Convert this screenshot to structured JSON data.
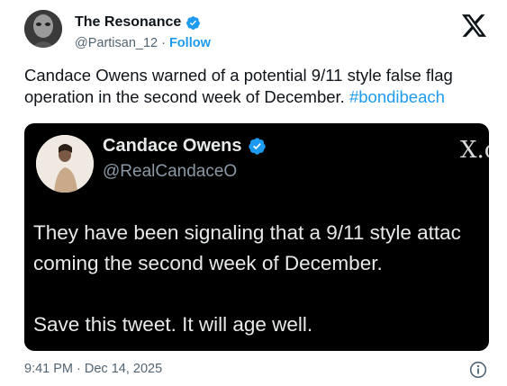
{
  "author": {
    "name": "The Resonance",
    "handle": "@Partisan_12",
    "separator": "·",
    "follow_label": "Follow",
    "verified_icon": "verified-badge-icon"
  },
  "brand_icon": "x-logo-icon",
  "tweet": {
    "text": "Candace Owens warned of a potential 9/11 style false flag operation in the second week of December.",
    "hashtag": "#bondibeach"
  },
  "quoted_tweet": {
    "name": "Candace Owens",
    "handle": "@RealCandaceO",
    "brand_glyph": "X.c",
    "line_1": "They have been signaling that a 9/11 style attac",
    "line_2": "coming the second week of December.",
    "line_3": "Save this tweet. It will age well."
  },
  "timestamp": "9:41 PM · Dec 14, 2025",
  "colors": {
    "accent": "#1d9bf0",
    "text": "#0f1419",
    "muted": "#536471",
    "quote_bg": "#000000"
  }
}
